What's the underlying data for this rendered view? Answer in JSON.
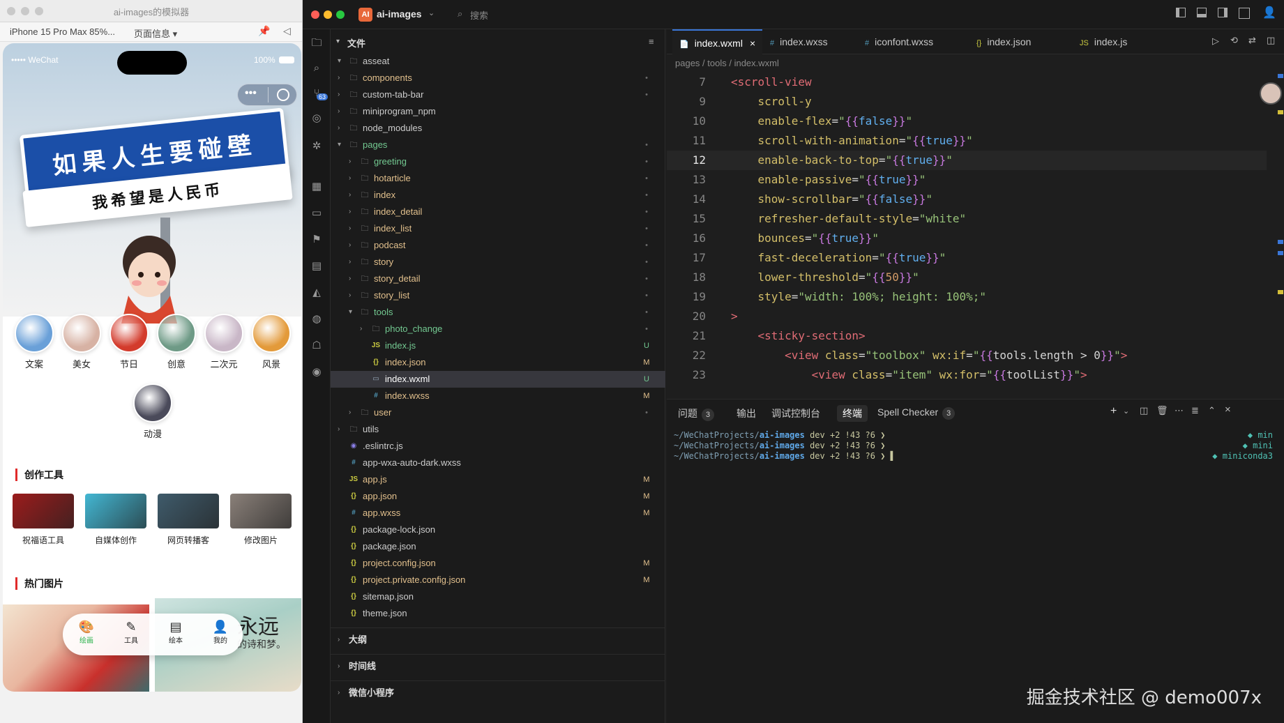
{
  "simulator": {
    "title": "ai-images的模拟器",
    "device": "iPhone 15 Pro Max 85%...",
    "page_info": "页面信息 ▾",
    "status": {
      "carrier": "••••• WeChat",
      "battery": "100%"
    },
    "hero": {
      "sign_main": "如果人生要碰壁",
      "sign_sub": "我希望是人民币"
    },
    "categories": [
      {
        "label": "文案",
        "color": "#6aa0d8"
      },
      {
        "label": "美女",
        "color": "#d7b2a4"
      },
      {
        "label": "节日",
        "color": "#d33b2c"
      },
      {
        "label": "创意",
        "color": "#6e9a86"
      },
      {
        "label": "二次元",
        "color": "#c9b7c7"
      },
      {
        "label": "风景",
        "color": "#e39a3a"
      },
      {
        "label": "动漫",
        "color": "#4a4a5a"
      }
    ],
    "sections": {
      "tools_title": "创作工具",
      "hot_title": "热门图片"
    },
    "tools": [
      {
        "label": "祝福语工具",
        "color": "#9b1c1c"
      },
      {
        "label": "自媒体创作",
        "color": "#43b7d3"
      },
      {
        "label": "网页转播客",
        "color": "#3f5b6b"
      },
      {
        "label": "修改图片",
        "color": "#8a8079"
      }
    ],
    "hot_text": {
      "right_title": "永远",
      "right_sub": "的诗和梦。"
    },
    "tabbar": [
      {
        "label": "绘画",
        "icon": "palette-icon",
        "active": true
      },
      {
        "label": "工具",
        "icon": "edit-icon",
        "active": false
      },
      {
        "label": "绘本",
        "icon": "book-icon",
        "active": false
      },
      {
        "label": "我的",
        "icon": "person-icon",
        "active": false
      }
    ]
  },
  "ide": {
    "project_name": "ai-images",
    "project_badge": "AI",
    "search_label": "搜索",
    "explorer_title": "文件",
    "tree": [
      {
        "name": "asseat",
        "type": "folder",
        "depth": 0,
        "open": true,
        "color": "#cccccc",
        "status": ""
      },
      {
        "name": "components",
        "type": "folder",
        "depth": 0,
        "open": false,
        "color": "#e2c08d",
        "status": "•"
      },
      {
        "name": "custom-tab-bar",
        "type": "folder",
        "depth": 0,
        "open": false,
        "color": "#cccccc",
        "status": "•"
      },
      {
        "name": "miniprogram_npm",
        "type": "folder",
        "depth": 0,
        "open": false,
        "color": "#cccccc",
        "status": ""
      },
      {
        "name": "node_modules",
        "type": "folder",
        "depth": 0,
        "open": false,
        "color": "#cccccc",
        "status": ""
      },
      {
        "name": "pages",
        "type": "folder",
        "depth": 0,
        "open": true,
        "color": "#73c991",
        "status": "•"
      },
      {
        "name": "greeting",
        "type": "folder",
        "depth": 1,
        "open": false,
        "color": "#73c991",
        "status": "•"
      },
      {
        "name": "hotarticle",
        "type": "folder",
        "depth": 1,
        "open": false,
        "color": "#e2c08d",
        "status": "•"
      },
      {
        "name": "index",
        "type": "folder",
        "depth": 1,
        "open": false,
        "color": "#e2c08d",
        "status": "•"
      },
      {
        "name": "index_detail",
        "type": "folder",
        "depth": 1,
        "open": false,
        "color": "#e2c08d",
        "status": "•"
      },
      {
        "name": "index_list",
        "type": "folder",
        "depth": 1,
        "open": false,
        "color": "#e2c08d",
        "status": "•"
      },
      {
        "name": "podcast",
        "type": "folder",
        "depth": 1,
        "open": false,
        "color": "#e2c08d",
        "status": "•"
      },
      {
        "name": "story",
        "type": "folder",
        "depth": 1,
        "open": false,
        "color": "#e2c08d",
        "status": "•"
      },
      {
        "name": "story_detail",
        "type": "folder",
        "depth": 1,
        "open": false,
        "color": "#e2c08d",
        "status": "•"
      },
      {
        "name": "story_list",
        "type": "folder",
        "depth": 1,
        "open": false,
        "color": "#e2c08d",
        "status": "•"
      },
      {
        "name": "tools",
        "type": "folder",
        "depth": 1,
        "open": true,
        "color": "#73c991",
        "status": "•"
      },
      {
        "name": "photo_change",
        "type": "folder",
        "depth": 2,
        "open": false,
        "color": "#73c991",
        "status": "•"
      },
      {
        "name": "index.js",
        "type": "js",
        "depth": 2,
        "color": "#73c991",
        "status": "U"
      },
      {
        "name": "index.json",
        "type": "json",
        "depth": 2,
        "color": "#e2c08d",
        "status": "M"
      },
      {
        "name": "index.wxml",
        "type": "wxml",
        "depth": 2,
        "color": "#73c991",
        "status": "U",
        "selected": true
      },
      {
        "name": "index.wxss",
        "type": "css",
        "depth": 2,
        "color": "#e2c08d",
        "status": "M"
      },
      {
        "name": "user",
        "type": "folder",
        "depth": 1,
        "open": false,
        "color": "#e2c08d",
        "status": "•"
      },
      {
        "name": "utils",
        "type": "folder",
        "depth": 0,
        "open": false,
        "color": "#cccccc",
        "status": ""
      },
      {
        "name": ".eslintrc.js",
        "type": "eslint",
        "depth": 0,
        "color": "#cccccc",
        "status": ""
      },
      {
        "name": "app-wxa-auto-dark.wxss",
        "type": "css",
        "depth": 0,
        "color": "#cccccc",
        "status": ""
      },
      {
        "name": "app.js",
        "type": "js",
        "depth": 0,
        "color": "#e2c08d",
        "status": "M"
      },
      {
        "name": "app.json",
        "type": "json",
        "depth": 0,
        "color": "#e2c08d",
        "status": "M"
      },
      {
        "name": "app.wxss",
        "type": "css",
        "depth": 0,
        "color": "#e2c08d",
        "status": "M"
      },
      {
        "name": "package-lock.json",
        "type": "json",
        "depth": 0,
        "color": "#cccccc",
        "status": ""
      },
      {
        "name": "package.json",
        "type": "json",
        "depth": 0,
        "color": "#cccccc",
        "status": ""
      },
      {
        "name": "project.config.json",
        "type": "json",
        "depth": 0,
        "color": "#e2c08d",
        "status": "M"
      },
      {
        "name": "project.private.config.json",
        "type": "json",
        "depth": 0,
        "color": "#e2c08d",
        "status": "M"
      },
      {
        "name": "sitemap.json",
        "type": "json",
        "depth": 0,
        "color": "#cccccc",
        "status": ""
      },
      {
        "name": "theme.json",
        "type": "json",
        "depth": 0,
        "color": "#cccccc",
        "status": ""
      }
    ],
    "collapsed_sections": [
      "大纲",
      "时间线",
      "微信小程序"
    ],
    "tabs": [
      {
        "label": "index.wxml",
        "icon": "📄",
        "active": true,
        "close": "×"
      },
      {
        "label": "index.wxss",
        "icon": "#",
        "active": false
      },
      {
        "label": "iconfont.wxss",
        "icon": "#",
        "active": false
      },
      {
        "label": "index.json",
        "icon": "{}",
        "active": false
      },
      {
        "label": "index.js",
        "icon": "JS",
        "active": false
      }
    ],
    "breadcrumb": [
      "pages",
      "tools",
      "index.wxml"
    ],
    "code_lines": [
      {
        "n": "7",
        "parts": [
          [
            "t-tag",
            "<scroll-view"
          ]
        ]
      },
      {
        "n": "9",
        "parts": [
          [
            "t-plain",
            "    "
          ],
          [
            "t-attr",
            "scroll-y"
          ]
        ]
      },
      {
        "n": "10",
        "parts": [
          [
            "t-plain",
            "    "
          ],
          [
            "t-attr",
            "enable-flex"
          ],
          [
            "t-plain",
            "="
          ],
          [
            "t-str",
            "\""
          ],
          [
            "t-brace",
            "{{"
          ],
          [
            "t-kw",
            "false"
          ],
          [
            "t-brace",
            "}}"
          ],
          [
            "t-str",
            "\""
          ]
        ]
      },
      {
        "n": "11",
        "parts": [
          [
            "t-plain",
            "    "
          ],
          [
            "t-attr",
            "scroll-with-animation"
          ],
          [
            "t-plain",
            "="
          ],
          [
            "t-str",
            "\""
          ],
          [
            "t-brace",
            "{{"
          ],
          [
            "t-kw",
            "true"
          ],
          [
            "t-brace",
            "}}"
          ],
          [
            "t-str",
            "\""
          ]
        ]
      },
      {
        "n": "12",
        "current": true,
        "parts": [
          [
            "t-plain",
            "    "
          ],
          [
            "t-attr",
            "enable-back-to-top"
          ],
          [
            "t-plain",
            "="
          ],
          [
            "t-str",
            "\""
          ],
          [
            "t-brace",
            "{{"
          ],
          [
            "t-kw",
            "true"
          ],
          [
            "t-brace",
            "}}"
          ],
          [
            "t-str",
            "\""
          ]
        ]
      },
      {
        "n": "13",
        "parts": [
          [
            "t-plain",
            "    "
          ],
          [
            "t-attr",
            "enable-passive"
          ],
          [
            "t-plain",
            "="
          ],
          [
            "t-str",
            "\""
          ],
          [
            "t-brace",
            "{{"
          ],
          [
            "t-kw",
            "true"
          ],
          [
            "t-brace",
            "}}"
          ],
          [
            "t-str",
            "\""
          ]
        ]
      },
      {
        "n": "14",
        "parts": [
          [
            "t-plain",
            "    "
          ],
          [
            "t-attr",
            "show-scrollbar"
          ],
          [
            "t-plain",
            "="
          ],
          [
            "t-str",
            "\""
          ],
          [
            "t-brace",
            "{{"
          ],
          [
            "t-kw",
            "false"
          ],
          [
            "t-brace",
            "}}"
          ],
          [
            "t-str",
            "\""
          ]
        ]
      },
      {
        "n": "15",
        "parts": [
          [
            "t-plain",
            "    "
          ],
          [
            "t-attr",
            "refresher-default-style"
          ],
          [
            "t-plain",
            "="
          ],
          [
            "t-str",
            "\"white\""
          ]
        ]
      },
      {
        "n": "16",
        "parts": [
          [
            "t-plain",
            "    "
          ],
          [
            "t-attr",
            "bounces"
          ],
          [
            "t-plain",
            "="
          ],
          [
            "t-str",
            "\""
          ],
          [
            "t-brace",
            "{{"
          ],
          [
            "t-kw",
            "true"
          ],
          [
            "t-brace",
            "}}"
          ],
          [
            "t-str",
            "\""
          ]
        ]
      },
      {
        "n": "17",
        "parts": [
          [
            "t-plain",
            "    "
          ],
          [
            "t-attr",
            "fast-deceleration"
          ],
          [
            "t-plain",
            "="
          ],
          [
            "t-str",
            "\""
          ],
          [
            "t-brace",
            "{{"
          ],
          [
            "t-kw",
            "true"
          ],
          [
            "t-brace",
            "}}"
          ],
          [
            "t-str",
            "\""
          ]
        ]
      },
      {
        "n": "18",
        "parts": [
          [
            "t-plain",
            "    "
          ],
          [
            "t-attr",
            "lower-threshold"
          ],
          [
            "t-plain",
            "="
          ],
          [
            "t-str",
            "\""
          ],
          [
            "t-brace",
            "{{"
          ],
          [
            "t-num",
            "50"
          ],
          [
            "t-brace",
            "}}"
          ],
          [
            "t-str",
            "\""
          ]
        ]
      },
      {
        "n": "19",
        "parts": [
          [
            "t-plain",
            "    "
          ],
          [
            "t-attr",
            "style"
          ],
          [
            "t-plain",
            "="
          ],
          [
            "t-str",
            "\"width: 100%; height: 100%;\""
          ]
        ]
      },
      {
        "n": "20",
        "parts": [
          [
            "t-tag",
            ">"
          ]
        ]
      },
      {
        "n": "21",
        "parts": [
          [
            "t-plain",
            "    "
          ],
          [
            "t-tag",
            "<sticky-section>"
          ]
        ]
      },
      {
        "n": "22",
        "parts": [
          [
            "t-plain",
            "        "
          ],
          [
            "t-tag",
            "<view "
          ],
          [
            "t-attr",
            "class"
          ],
          [
            "t-plain",
            "="
          ],
          [
            "t-str",
            "\"toolbox\" "
          ],
          [
            "t-attr",
            "wx:if"
          ],
          [
            "t-plain",
            "="
          ],
          [
            "t-str",
            "\""
          ],
          [
            "t-brace",
            "{{"
          ],
          [
            "t-plain",
            "tools.length > 0"
          ],
          [
            "t-brace",
            "}}"
          ],
          [
            "t-str",
            "\""
          ],
          [
            "t-tag",
            ">"
          ]
        ]
      },
      {
        "n": "23",
        "parts": [
          [
            "t-plain",
            "            "
          ],
          [
            "t-tag",
            "<view "
          ],
          [
            "t-attr",
            "class"
          ],
          [
            "t-plain",
            "="
          ],
          [
            "t-str",
            "\"item\" "
          ],
          [
            "t-attr",
            "wx:for"
          ],
          [
            "t-plain",
            "="
          ],
          [
            "t-str",
            "\""
          ],
          [
            "t-brace",
            "{{"
          ],
          [
            "t-plain",
            "toolList"
          ],
          [
            "t-brace",
            "}}"
          ],
          [
            "t-str",
            "\""
          ],
          [
            "t-tag",
            ">"
          ]
        ]
      }
    ],
    "panel_tabs": [
      {
        "label": "问题",
        "badge": "3"
      },
      {
        "label": "输出",
        "badge": ""
      },
      {
        "label": "调试控制台",
        "badge": ""
      },
      {
        "label": "终端",
        "badge": "",
        "active": true
      },
      {
        "label": "Spell Checker",
        "badge": "3"
      }
    ],
    "terminal_lines": [
      {
        "path": "~/WeChatProjects/",
        "proj": "ai-images",
        "rest": " dev +2 !43 ?6 ❯",
        "right": "◆ min"
      },
      {
        "path": "~/WeChatProjects/",
        "proj": "ai-images",
        "rest": " dev +2 !43 ?6 ❯",
        "right": "◆ mini"
      },
      {
        "path": "~/WeChatProjects/",
        "proj": "ai-images",
        "rest": " dev +2 !43 ?6 ❯ ▌",
        "right": "◆ miniconda3"
      }
    ],
    "activity_badge": "63"
  },
  "watermark": "掘金技术社区 @ demo007x"
}
